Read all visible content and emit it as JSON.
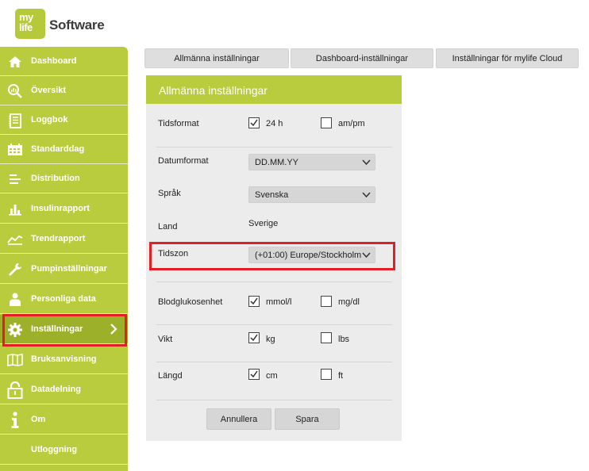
{
  "brand": {
    "logo_line1": "my",
    "logo_line2": "life",
    "name": "Software",
    "accent": "#b8cc3d",
    "highlight": "#e31e24"
  },
  "sidebar": {
    "items": [
      {
        "label": "Dashboard",
        "icon": "home-icon"
      },
      {
        "label": "Översikt",
        "icon": "overview-icon"
      },
      {
        "label": "Loggbok",
        "icon": "logbook-icon"
      },
      {
        "label": "Standarddag",
        "icon": "calendar-icon"
      },
      {
        "label": "Distribution",
        "icon": "distribution-icon"
      },
      {
        "label": "Insulinrapport",
        "icon": "bar-chart-icon"
      },
      {
        "label": "Trendrapport",
        "icon": "trend-icon"
      },
      {
        "label": "Pumpinställningar",
        "icon": "wrench-icon"
      },
      {
        "label": "Personliga data",
        "icon": "person-icon"
      },
      {
        "label": "Inställningar",
        "icon": "gear-icon",
        "active": true
      },
      {
        "label": "Bruksanvisning",
        "icon": "map-book-icon"
      },
      {
        "label": "Datadelning",
        "icon": "lock-icon"
      },
      {
        "label": "Om",
        "icon": "info-icon"
      },
      {
        "label": "Utloggning",
        "icon": ""
      }
    ]
  },
  "tabs": [
    {
      "label": "Allmänna inställningar"
    },
    {
      "label": "Dashboard-inställningar"
    },
    {
      "label": "Inställningar för mylife Cloud"
    }
  ],
  "panel": {
    "title": "Allmänna inställningar",
    "time_format": {
      "label": "Tidsformat",
      "opt1": "24 h",
      "opt1_checked": true,
      "opt2": "am/pm",
      "opt2_checked": false
    },
    "date_format": {
      "label": "Datumformat",
      "value": "DD.MM.YY"
    },
    "language": {
      "label": "Språk",
      "value": "Svenska"
    },
    "country": {
      "label": "Land",
      "value": "Sverige"
    },
    "timezone": {
      "label": "Tidszon",
      "value": "(+01:00) Europe/Stockholm"
    },
    "glucose_unit": {
      "label": "Blodglukosenhet",
      "opt1": "mmol/l",
      "opt1_checked": true,
      "opt2": "mg/dl",
      "opt2_checked": false
    },
    "weight": {
      "label": "Vikt",
      "opt1": "kg",
      "opt1_checked": true,
      "opt2": "lbs",
      "opt2_checked": false
    },
    "height": {
      "label": "Längd",
      "opt1": "cm",
      "opt1_checked": true,
      "opt2": "ft",
      "opt2_checked": false
    },
    "cancel_label": "Annullera",
    "save_label": "Spara"
  }
}
